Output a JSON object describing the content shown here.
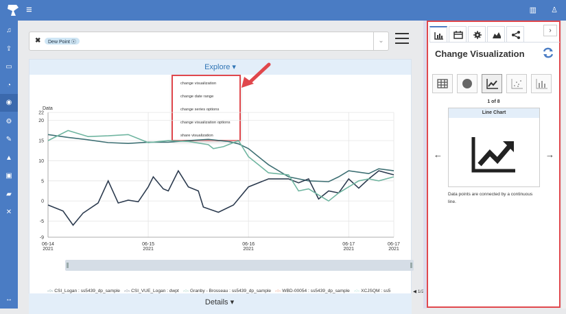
{
  "header": {
    "menu_glyph": "≡",
    "icon_book": "▥",
    "icon_user": "♙"
  },
  "sidebar_icons": [
    "bell-icon",
    "upload-icon",
    "monitor-icon",
    "dashboard-icon",
    "explore-icon",
    "settings-icon",
    "tag-icon",
    "area-chart-icon",
    "briefcase-icon",
    "car-icon",
    "tools-icon"
  ],
  "filter": {
    "clear": "✖",
    "tag": "Dew Point ⓧ",
    "caret": "⌄"
  },
  "explore": {
    "label": "Explore ▾",
    "menu": [
      "change visualization",
      "change date range",
      "change series options",
      "change visualization options",
      "share visualization"
    ]
  },
  "chart_data": {
    "type": "line",
    "ylabel": "Data",
    "ylim": [
      -9,
      22
    ],
    "yticks": [
      22,
      20,
      15,
      10,
      5,
      0,
      -5,
      -9
    ],
    "xticks": [
      {
        "top": "06-14",
        "bottom": "2021",
        "t": 0
      },
      {
        "top": "06-15",
        "bottom": "2021",
        "t": 1
      },
      {
        "top": "06-16",
        "bottom": "2021",
        "t": 2
      },
      {
        "top": "06-17",
        "bottom": "2021",
        "t": 3
      },
      {
        "top": "06-17",
        "bottom": "2021",
        "t": 3.45
      }
    ],
    "series": [
      {
        "name": "CSI_Logan : ss5439_dp_sample",
        "color": "#3d6f73",
        "points": [
          [
            0,
            16.5
          ],
          [
            0.2,
            15.8
          ],
          [
            0.4,
            15.2
          ],
          [
            0.6,
            14.5
          ],
          [
            0.8,
            14.3
          ],
          [
            1,
            14.6
          ],
          [
            1.2,
            14.6
          ],
          [
            1.4,
            15
          ],
          [
            1.6,
            15.3
          ],
          [
            1.8,
            14.8
          ],
          [
            1.9,
            14.2
          ],
          [
            2,
            13
          ],
          [
            2.1,
            11
          ],
          [
            2.2,
            9
          ],
          [
            2.3,
            7.5
          ],
          [
            2.4,
            6
          ],
          [
            2.5,
            5.5
          ],
          [
            2.6,
            5
          ],
          [
            2.8,
            4.8
          ],
          [
            2.9,
            6
          ],
          [
            3,
            7.5
          ],
          [
            3.2,
            6.8
          ],
          [
            3.3,
            8
          ],
          [
            3.45,
            7.5
          ]
        ]
      },
      {
        "name": "CSI_VUE_Logan : dwpt",
        "color": "#2b3a4e",
        "points": [
          [
            0,
            -1
          ],
          [
            0.15,
            -2.5
          ],
          [
            0.25,
            -6
          ],
          [
            0.35,
            -3
          ],
          [
            0.5,
            -0.5
          ],
          [
            0.6,
            5
          ],
          [
            0.7,
            -0.5
          ],
          [
            0.8,
            0.2
          ],
          [
            0.9,
            -0.2
          ],
          [
            1,
            3.5
          ],
          [
            1.05,
            6
          ],
          [
            1.15,
            3
          ],
          [
            1.2,
            2.5
          ],
          [
            1.3,
            7.5
          ],
          [
            1.4,
            3.5
          ],
          [
            1.5,
            2.5
          ],
          [
            1.55,
            -1.5
          ],
          [
            1.7,
            -2.8
          ],
          [
            1.85,
            -1
          ],
          [
            2,
            3.5
          ],
          [
            2.2,
            5.5
          ],
          [
            2.4,
            5.5
          ],
          [
            2.5,
            4.5
          ],
          [
            2.6,
            5.5
          ],
          [
            2.7,
            0.5
          ],
          [
            2.8,
            2.5
          ],
          [
            2.9,
            2
          ],
          [
            3,
            5.5
          ],
          [
            3.1,
            3.2
          ],
          [
            3.2,
            5.5
          ],
          [
            3.3,
            7.5
          ],
          [
            3.45,
            6.5
          ]
        ]
      },
      {
        "name": "Granby - Brosseau : ss5439_dp_sample",
        "color": "#6fb5a0",
        "points": [
          [
            0,
            15
          ],
          [
            0.2,
            17.5
          ],
          [
            0.4,
            16
          ],
          [
            0.6,
            16.2
          ],
          [
            0.8,
            16.5
          ],
          [
            1,
            14.5
          ],
          [
            1.2,
            15
          ],
          [
            1.4,
            14.8
          ],
          [
            1.6,
            14
          ],
          [
            1.65,
            13
          ],
          [
            1.75,
            13.5
          ],
          [
            1.9,
            15
          ],
          [
            2,
            11
          ],
          [
            2.1,
            9
          ],
          [
            2.2,
            7
          ],
          [
            2.4,
            6.5
          ],
          [
            2.5,
            2.5
          ],
          [
            2.6,
            3
          ],
          [
            2.7,
            1.5
          ],
          [
            2.8,
            0
          ],
          [
            2.9,
            2
          ],
          [
            3,
            3.5
          ],
          [
            3.1,
            5
          ],
          [
            3.2,
            5.5
          ],
          [
            3.3,
            5
          ],
          [
            3.45,
            6
          ]
        ]
      },
      {
        "name": "WBD-00054 : ss5439_dp_sample",
        "color": "#e0704c",
        "points": []
      },
      {
        "name": "XCJSQM : ss5",
        "color": "#8fd4c6",
        "points": []
      }
    ],
    "legend_placement": "bottom",
    "legend_page": "1/2"
  },
  "details": {
    "label": "Details ▾"
  },
  "right_panel": {
    "next_glyph": "›",
    "title": "Change Visualization",
    "counter": "1 of 8",
    "card_title": "Line Chart",
    "prev_glyph": "←",
    "next_arrow_glyph": "→",
    "description": "Data points are connected by a continuous line."
  }
}
